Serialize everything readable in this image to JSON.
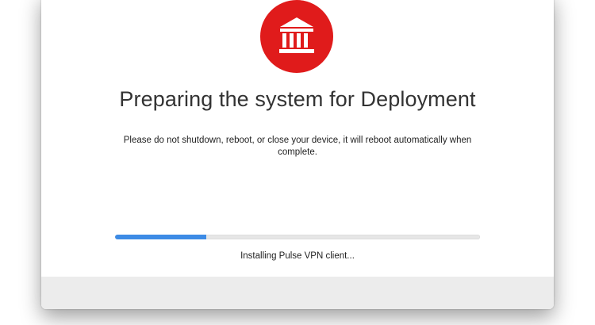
{
  "window": {
    "title": "Preparing the system for Deployment",
    "message": "Please do not shutdown, reboot, or close your device, it will reboot automatically when complete.",
    "status": "Installing Pulse VPN client...",
    "progress": 0.25
  },
  "logo": {
    "icon": "bank-building-icon",
    "color": "#e01b1b"
  },
  "colors": {
    "progress_fill": "#3d8be5",
    "progress_track": "#e6e6e6",
    "footer": "#ececec"
  }
}
